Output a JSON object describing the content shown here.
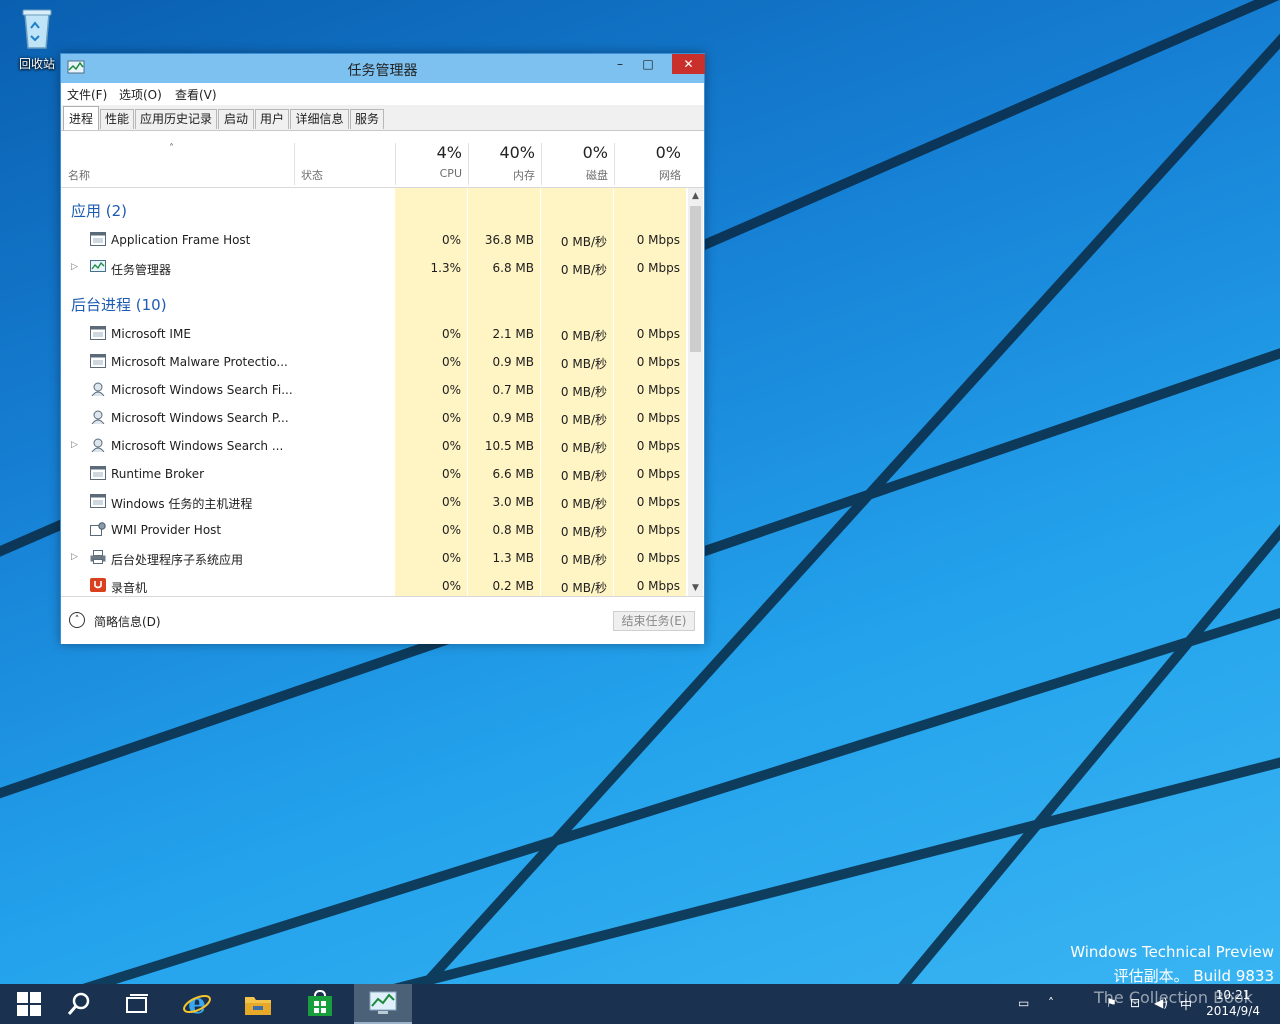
{
  "desktop": {
    "recycle_bin_label": "回收站",
    "watermark_line1": "Windows Technical Preview",
    "watermark_line2": "评估副本。 Build 9833"
  },
  "window": {
    "title": "任务管理器",
    "controls": {
      "minimize": "–",
      "maximize": "□",
      "close": "✕"
    },
    "menu": [
      "文件(F)",
      "选项(O)",
      "查看(V)"
    ],
    "tabs": [
      "进程",
      "性能",
      "应用历史记录",
      "启动",
      "用户",
      "详细信息",
      "服务"
    ],
    "active_tab": "进程",
    "columns": {
      "name": "名称",
      "status": "状态",
      "cpu": {
        "pct": "4%",
        "label": "CPU"
      },
      "memory": {
        "pct": "40%",
        "label": "内存"
      },
      "disk": {
        "pct": "0%",
        "label": "磁盘"
      },
      "network": {
        "pct": "0%",
        "label": "网络"
      }
    },
    "groups": [
      {
        "title": "应用 (2)",
        "rows": [
          {
            "name": "Application Frame Host",
            "icon": "window-icon",
            "expandable": false,
            "cpu": "0%",
            "mem": "36.8 MB",
            "disk": "0 MB/秒",
            "net": "0 Mbps"
          },
          {
            "name": "任务管理器",
            "icon": "task-manager-icon",
            "expandable": true,
            "cpu": "1.3%",
            "mem": "6.8 MB",
            "disk": "0 MB/秒",
            "net": "0 Mbps"
          }
        ]
      },
      {
        "title": "后台进程 (10)",
        "rows": [
          {
            "name": "Microsoft IME",
            "icon": "window-icon",
            "expandable": false,
            "cpu": "0%",
            "mem": "2.1 MB",
            "disk": "0 MB/秒",
            "net": "0 Mbps"
          },
          {
            "name": "Microsoft Malware Protectio...",
            "icon": "window-icon",
            "expandable": false,
            "cpu": "0%",
            "mem": "0.9 MB",
            "disk": "0 MB/秒",
            "net": "0 Mbps"
          },
          {
            "name": "Microsoft Windows Search Fi...",
            "icon": "search-service-icon",
            "expandable": false,
            "cpu": "0%",
            "mem": "0.7 MB",
            "disk": "0 MB/秒",
            "net": "0 Mbps"
          },
          {
            "name": "Microsoft Windows Search P...",
            "icon": "search-service-icon",
            "expandable": false,
            "cpu": "0%",
            "mem": "0.9 MB",
            "disk": "0 MB/秒",
            "net": "0 Mbps"
          },
          {
            "name": "Microsoft Windows Search ...",
            "icon": "search-service-icon",
            "expandable": true,
            "cpu": "0%",
            "mem": "10.5 MB",
            "disk": "0 MB/秒",
            "net": "0 Mbps"
          },
          {
            "name": "Runtime Broker",
            "icon": "window-icon",
            "expandable": false,
            "cpu": "0%",
            "mem": "6.6 MB",
            "disk": "0 MB/秒",
            "net": "0 Mbps"
          },
          {
            "name": "Windows 任务的主机进程",
            "icon": "window-icon",
            "expandable": false,
            "cpu": "0%",
            "mem": "3.0 MB",
            "disk": "0 MB/秒",
            "net": "0 Mbps"
          },
          {
            "name": "WMI Provider Host",
            "icon": "wmi-icon",
            "expandable": false,
            "cpu": "0%",
            "mem": "0.8 MB",
            "disk": "0 MB/秒",
            "net": "0 Mbps"
          },
          {
            "name": "后台处理程序子系统应用",
            "icon": "printer-icon",
            "expandable": true,
            "cpu": "0%",
            "mem": "1.3 MB",
            "disk": "0 MB/秒",
            "net": "0 Mbps"
          },
          {
            "name": "录音机",
            "icon": "recorder-icon",
            "expandable": false,
            "cpu": "0%",
            "mem": "0.2 MB",
            "disk": "0 MB/秒",
            "net": "0 Mbps"
          }
        ]
      }
    ],
    "footer": {
      "fewer_details": "简略信息(D)",
      "end_task": "结束任务(E)"
    }
  },
  "taskbar": {
    "items": [
      "start-icon",
      "search-icon",
      "task-view-icon",
      "internet-explorer-icon",
      "file-explorer-icon",
      "store-icon",
      "task-manager-icon"
    ],
    "active_item": "task-manager-icon",
    "tray_overlay_text": "The Collection Book",
    "tray_input_label": "中",
    "clock_time": "10:21",
    "clock_date": "2014/9/4"
  },
  "colors": {
    "accent_blue": "#1e5bb3",
    "titlebar": "#7cc1ef",
    "close_red": "#c9302c",
    "heat_light": "#fff4c4",
    "heat_mid": "#ffe8a0",
    "taskbar": "#1a3150"
  }
}
